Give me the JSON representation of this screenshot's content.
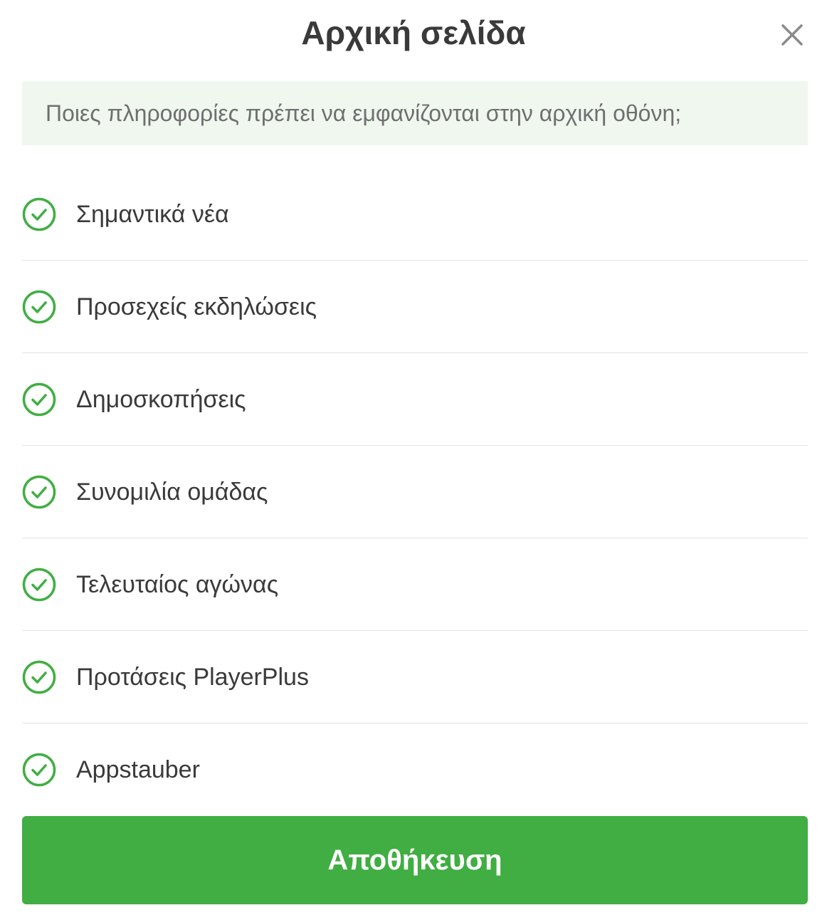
{
  "header": {
    "title": "Αρχική σελίδα",
    "close_icon": "close-icon"
  },
  "banner": {
    "text": "Ποιες πληροφορίες πρέπει να εμφανίζονται στην αρχική οθόνη;"
  },
  "options": [
    {
      "label": "Σημαντικά νέα",
      "checked": true,
      "icon": "check-circle-icon"
    },
    {
      "label": "Προσεχείς εκδηλώσεις",
      "checked": true,
      "icon": "check-circle-icon"
    },
    {
      "label": "Δημοσκοπήσεις",
      "checked": true,
      "icon": "check-circle-icon"
    },
    {
      "label": "Συνομιλία ομάδας",
      "checked": true,
      "icon": "check-circle-icon"
    },
    {
      "label": "Τελευταίος αγώνας",
      "checked": true,
      "icon": "check-circle-icon"
    },
    {
      "label": "Προτάσεις PlayerPlus",
      "checked": true,
      "icon": "check-circle-icon"
    },
    {
      "label": "Appstauber",
      "checked": true,
      "icon": "check-circle-icon"
    }
  ],
  "save_button": {
    "label": "Αποθήκευση"
  },
  "colors": {
    "accent": "#40ae42",
    "banner_bg": "#eff7ef",
    "text": "#3a3a3a",
    "muted_text": "#6f6f6f",
    "divider": "#e2e2e2"
  }
}
